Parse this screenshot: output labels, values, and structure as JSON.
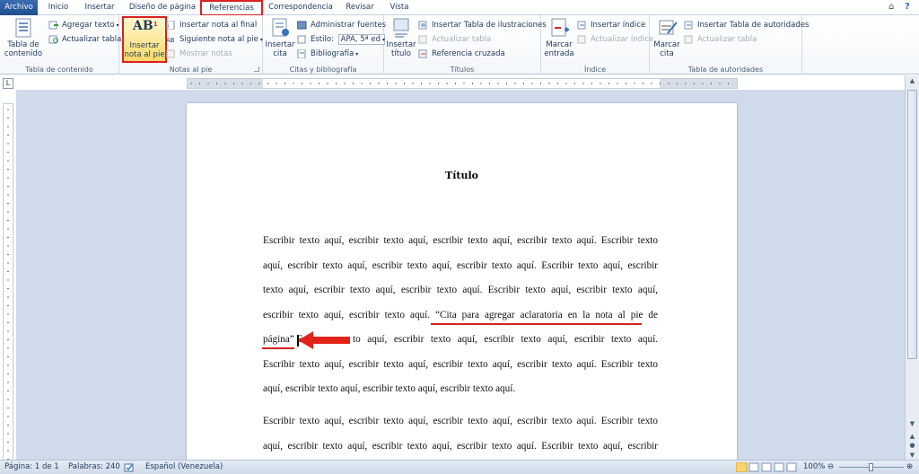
{
  "tabs": [
    "Archivo",
    "Inicio",
    "Insertar",
    "Diseño de página",
    "Referencias",
    "Correspondencia",
    "Revisar",
    "Vista"
  ],
  "window_controls": {
    "help": "?",
    "restore": "⌂"
  },
  "ribbon": {
    "toc": {
      "label": "Tabla de contenido",
      "big": "Tabla de\ncontenido",
      "add_text": "Agregar texto",
      "update": "Actualizar tabla"
    },
    "footnotes": {
      "label": "Notas al pie",
      "big_icon": "AB",
      "big_sup": "1",
      "big": "Insertar\nnota al pie",
      "endnote": "Insertar nota al final",
      "next": "Siguiente nota al pie",
      "show": "Mostrar notas"
    },
    "citations": {
      "label": "Citas y bibliografía",
      "big": "Insertar\ncita",
      "manage": "Administrar fuentes",
      "style_label": "Estilo:",
      "style_value": "APA, 5ª ed",
      "bibliography": "Bibliografía"
    },
    "captions": {
      "label": "Títulos",
      "big": "Insertar\ntítulo",
      "insert_table": "Insertar Tabla de ilustraciones",
      "update": "Actualizar tabla",
      "cross_ref": "Referencia cruzada"
    },
    "index": {
      "label": "Índice",
      "big": "Marcar\nentrada",
      "insert": "Insertar índice",
      "update": "Actualizar índice"
    },
    "authorities": {
      "label": "Tabla de autoridades",
      "big": "Marcar\ncita",
      "insert": "Insertar Tabla de autoridades",
      "update": "Actualizar tabla"
    }
  },
  "document": {
    "title": "Título",
    "lines": [
      "Escribir texto aquí, escribir texto aquí, escribir texto aquí, escribir texto aquí. Escribir texto",
      "aquí, escribir texto aquí, escribir texto aquí, escribir texto aquí. Escribir texto aquí, escribir",
      "texto aquí, escribir texto aquí, escribir texto aquí. Escribir texto aquí, escribir texto aquí,",
      "escribir texto aquí, escribir texto aquí. “Cita para agregar aclaratoria en la nota al pie de",
      "página” E",
      "to aquí, escribir texto aquí, escribir texto aquí, escribir texto aquí.",
      "Escribir texto aquí, escribir texto aquí, escribir texto aquí, escribir texto aquí. Escribir texto",
      "aquí, escribir texto aquí, escribir texto aquí, escribir texto aquí.",
      "Escribir texto aquí, escribir texto aquí, escribir texto aquí, escribir texto aquí. Escribir texto",
      "aquí, escribir texto aquí, escribir texto aquí, escribir texto aquí. Escribir texto aquí, escribir"
    ]
  },
  "status": {
    "page": "Página: 1 de 1",
    "words": "Palabras: 240",
    "language": "Español (Venezuela)",
    "zoom": "100%"
  },
  "colors": {
    "accent": "#2b579a",
    "highlight": "#d9211f",
    "ribbon_text": "#1e395b"
  }
}
